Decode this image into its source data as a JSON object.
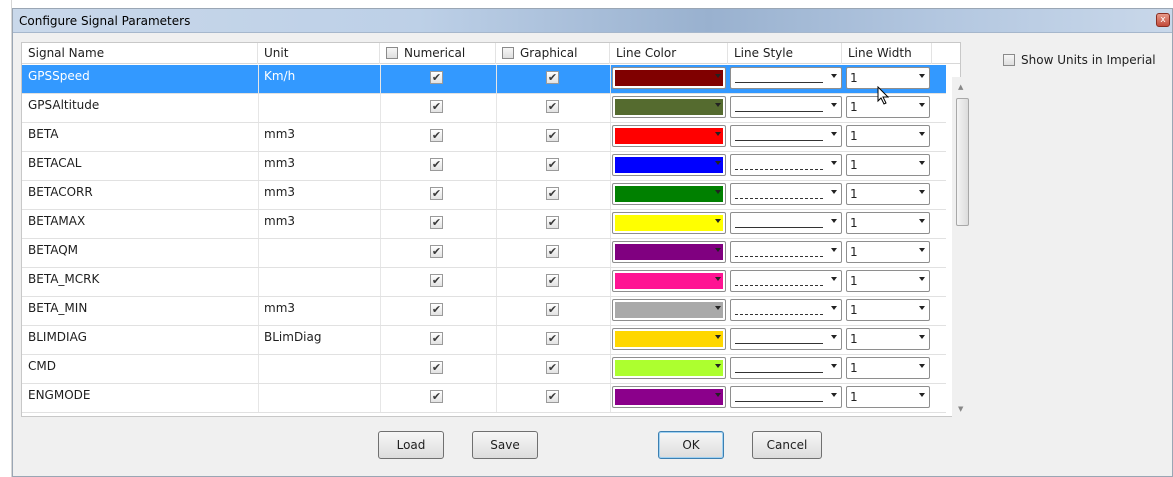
{
  "window": {
    "title": "Configure Signal Parameters"
  },
  "header": {
    "signal_name": "Signal Name",
    "unit": "Unit",
    "numerical": "Numerical",
    "graphical": "Graphical",
    "line_color": "Line Color",
    "line_style": "Line Style",
    "line_width": "Line Width"
  },
  "show_units_label": "Show Units in Imperial",
  "rows": [
    {
      "name": "GPSSpeed",
      "unit": "Km/h",
      "color": "#800000",
      "style": "solid",
      "width": "1"
    },
    {
      "name": "GPSAltitude",
      "unit": "",
      "color": "#556b2f",
      "style": "solid",
      "width": "1"
    },
    {
      "name": "BETA",
      "unit": "mm3",
      "color": "#ff0000",
      "style": "solid",
      "width": "1"
    },
    {
      "name": "BETACAL",
      "unit": "mm3",
      "color": "#0000ff",
      "style": "dashed",
      "width": "1"
    },
    {
      "name": "BETACORR",
      "unit": "mm3",
      "color": "#008000",
      "style": "dashed",
      "width": "1"
    },
    {
      "name": "BETAMAX",
      "unit": "mm3",
      "color": "#ffff00",
      "style": "solid",
      "width": "1"
    },
    {
      "name": "BETAQM",
      "unit": "",
      "color": "#800080",
      "style": "dashed",
      "width": "1"
    },
    {
      "name": "BETA_MCRK",
      "unit": "",
      "color": "#ff1493",
      "style": "dashed",
      "width": "1"
    },
    {
      "name": "BETA_MIN",
      "unit": "mm3",
      "color": "#a9a9a9",
      "style": "dashed",
      "width": "1"
    },
    {
      "name": "BLIMDIAG",
      "unit": "BLimDiag",
      "color": "#ffd700",
      "style": "solid",
      "width": "1"
    },
    {
      "name": "CMD",
      "unit": "",
      "color": "#adff2f",
      "style": "solid",
      "width": "1"
    },
    {
      "name": "ENGMODE",
      "unit": "",
      "color": "#8b008b",
      "style": "solid",
      "width": "1"
    }
  ],
  "buttons": {
    "load": "Load",
    "save": "Save",
    "ok": "OK",
    "cancel": "Cancel"
  },
  "colors": {
    "selection": "#3399ff",
    "check_mark": "#3a3a3a"
  },
  "glyphs": {
    "check": "✔",
    "close": "x",
    "scroll_up": "▲",
    "scroll_down": "▼"
  }
}
